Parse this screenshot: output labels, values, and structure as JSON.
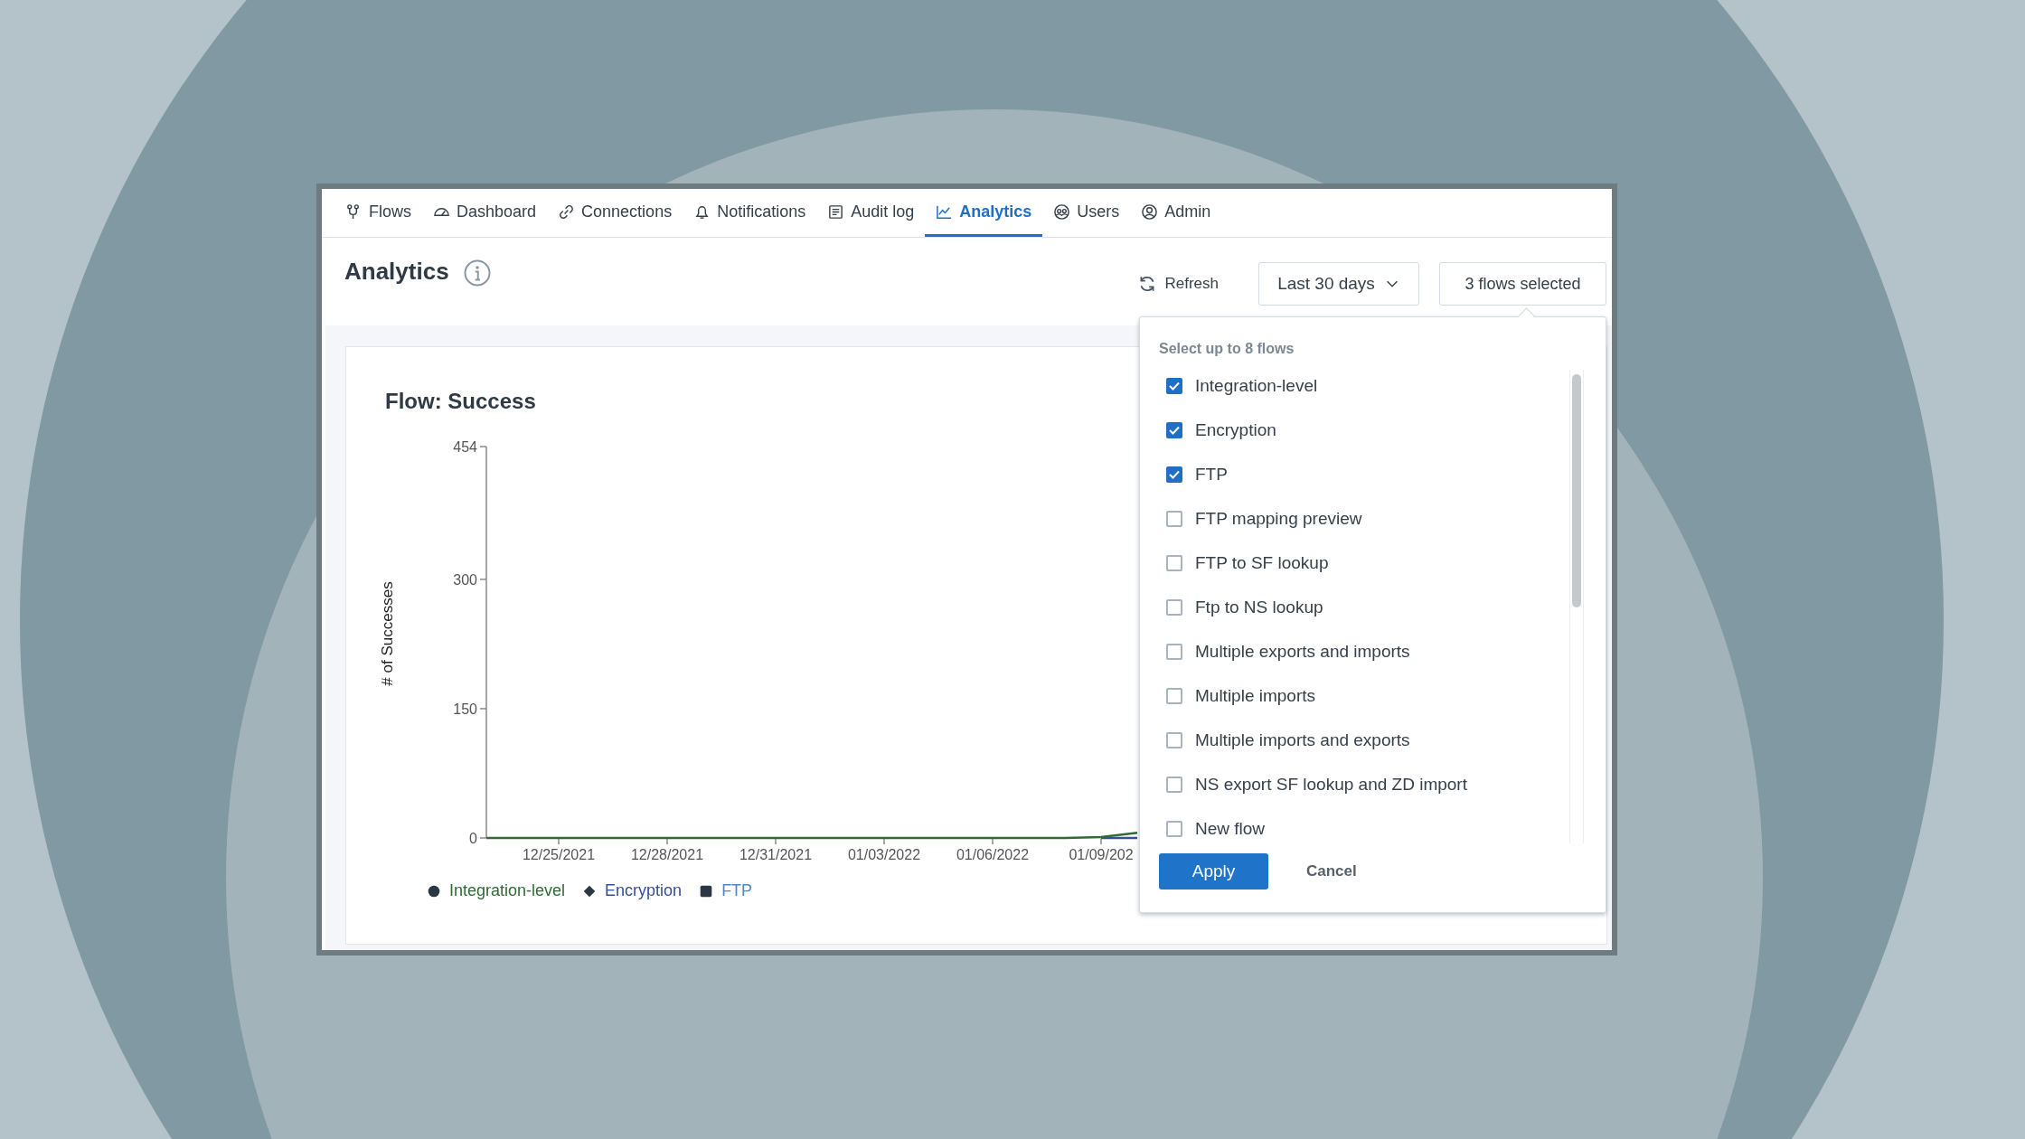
{
  "tabs": [
    {
      "label": "Flows",
      "selected": false
    },
    {
      "label": "Dashboard",
      "selected": false
    },
    {
      "label": "Connections",
      "selected": false
    },
    {
      "label": "Notifications",
      "selected": false
    },
    {
      "label": "Audit log",
      "selected": false
    },
    {
      "label": "Analytics",
      "selected": true
    },
    {
      "label": "Users",
      "selected": false
    },
    {
      "label": "Admin",
      "selected": false
    }
  ],
  "page": {
    "title": "Analytics"
  },
  "toolbar": {
    "refresh": "Refresh",
    "range": "Last 30 days",
    "flows_button": "3 flows selected"
  },
  "chart": {
    "chart_data": {
      "type": "line",
      "title": "Flow: Success",
      "ylabel": "# of Successes",
      "ylim": [
        0,
        454
      ],
      "yticks": [
        0,
        150,
        300,
        454
      ],
      "categories": [
        null,
        null,
        "12/25/2021",
        null,
        null,
        "12/28/2021",
        null,
        null,
        "12/31/2021",
        null,
        null,
        "01/03/2022",
        null,
        null,
        "01/06/2022",
        null,
        null,
        "01/09/202",
        null
      ],
      "series": [
        {
          "name": "Integration-level",
          "color": "#2e6b35",
          "values": [
            0,
            0,
            0,
            0,
            0,
            0,
            0,
            0,
            0,
            0,
            0,
            0,
            0,
            0,
            0,
            0,
            0,
            1,
            6
          ]
        },
        {
          "name": "Encryption",
          "color": "#34509a",
          "values": [
            null,
            null,
            null,
            null,
            null,
            null,
            null,
            null,
            null,
            null,
            null,
            null,
            null,
            null,
            null,
            null,
            null,
            0,
            0
          ]
        },
        {
          "name": "FTP",
          "color": "#4f86c6",
          "values": [
            null,
            null,
            null,
            null,
            null,
            null,
            null,
            null,
            null,
            null,
            null,
            null,
            null,
            null,
            null,
            null,
            null,
            null,
            null
          ]
        }
      ]
    }
  },
  "flow_picker": {
    "heading": "Select up to 8 flows",
    "flows": [
      {
        "label": "Integration-level",
        "checked": true
      },
      {
        "label": "Encryption",
        "checked": true
      },
      {
        "label": "FTP",
        "checked": true
      },
      {
        "label": "FTP mapping preview",
        "checked": false
      },
      {
        "label": "FTP to SF lookup",
        "checked": false
      },
      {
        "label": "Ftp to NS lookup",
        "checked": false
      },
      {
        "label": "Multiple exports and imports",
        "checked": false
      },
      {
        "label": "Multiple imports",
        "checked": false
      },
      {
        "label": "Multiple imports and exports",
        "checked": false
      },
      {
        "label": "NS export SF lookup and ZD import",
        "checked": false
      },
      {
        "label": "New flow",
        "checked": false
      }
    ],
    "apply": "Apply",
    "cancel": "Cancel"
  }
}
